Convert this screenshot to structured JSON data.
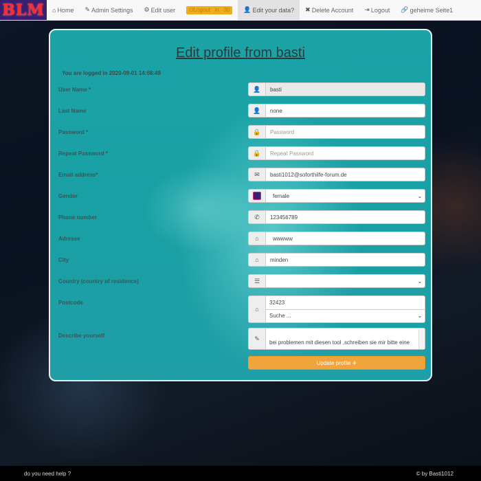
{
  "navbar": {
    "brand": "BLM",
    "items": [
      {
        "icon": "home-icon",
        "glyph": "⌂",
        "label": "Home"
      },
      {
        "icon": "wrench-icon",
        "glyph": "✎",
        "label": "Admin Settings"
      },
      {
        "icon": "gear-icon",
        "glyph": "⚙",
        "label": "Edit user"
      },
      {
        "icon": "logout-icon",
        "glyph": "⏻",
        "label": "Logout   in   30"
      },
      {
        "icon": "user-icon",
        "glyph": "👤",
        "label": "Edit your data?"
      },
      {
        "icon": "close-icon",
        "glyph": "✖",
        "label": "Delete Account"
      },
      {
        "icon": "signout-icon",
        "glyph": "⇥",
        "label": "Logout"
      },
      {
        "icon": "link-icon",
        "glyph": "🔗",
        "label": "geheime Seite1"
      }
    ]
  },
  "form": {
    "title": "Edit profile from basti",
    "logged_in": "You are logged in 2020-09-01 14:08:49",
    "fields": [
      {
        "label": "User Name *",
        "icon": "user-icon",
        "value": "basti",
        "placeholder": ""
      },
      {
        "label": "Last Name",
        "icon": "user-icon",
        "value": "none",
        "placeholder": ""
      },
      {
        "label": "Password *",
        "icon": "lock-icon",
        "value": "",
        "placeholder": "Password"
      },
      {
        "label": "Repeat Password *",
        "icon": "lock-icon",
        "value": "",
        "placeholder": "Repeat Password"
      },
      {
        "label": "Email address*",
        "icon": "envelope-icon",
        "value": "basti1012@soforthilfe-forum.de",
        "placeholder": ""
      },
      {
        "label": "Gender",
        "icon": "gender-icon",
        "value": "female",
        "placeholder": ""
      },
      {
        "label": "Phone number",
        "icon": "phone-icon",
        "value": "123456789",
        "placeholder": ""
      },
      {
        "label": "Adresse",
        "icon": "home-icon",
        "value": "wwwww",
        "placeholder": ""
      },
      {
        "label": "City",
        "icon": "home-icon",
        "value": "minden",
        "placeholder": ""
      },
      {
        "label": "Country (country of residence)",
        "icon": "list-icon",
        "value": "",
        "placeholder": ""
      },
      {
        "label": "Postcode",
        "icon": "home-icon",
        "value": "32423",
        "placeholder": ""
      },
      {
        "label": "",
        "icon": "",
        "value": "Suche ...",
        "placeholder": ""
      },
      {
        "label": "Describe yourself",
        "icon": "pencil-icon",
        "value": "bei problemen mit diesen tool ,schreiben sie mir bitte eine",
        "placeholder": ""
      }
    ],
    "submit": "Update profile ✈"
  },
  "footer": {
    "help": "do you need help ?",
    "copyright": "© by Basti1012"
  }
}
